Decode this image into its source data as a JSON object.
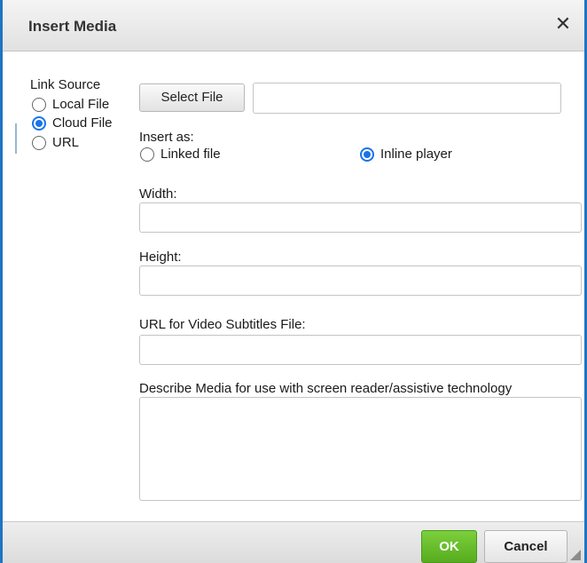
{
  "dialog": {
    "title": "Insert Media",
    "close_glyph": "✕",
    "close_icon": "close-icon"
  },
  "link_source": {
    "label": "Link Source",
    "options": [
      {
        "label": "Local File",
        "checked": false
      },
      {
        "label": "Cloud File",
        "checked": true
      },
      {
        "label": "URL",
        "checked": false
      }
    ]
  },
  "file": {
    "select_button": "Select File",
    "path_value": ""
  },
  "insert_as": {
    "label": "Insert as:",
    "options": [
      {
        "label": "Linked file",
        "checked": false
      },
      {
        "label": "Inline player",
        "checked": true
      }
    ]
  },
  "fields": {
    "width_label": "Width:",
    "width_value": "",
    "height_label": "Height:",
    "height_value": "",
    "subtitles_label": "URL for Video Subtitles File:",
    "subtitles_value": "",
    "describe_label": "Describe Media for use with screen reader/assistive technology",
    "describe_value": ""
  },
  "footer": {
    "ok_label": "OK",
    "cancel_label": "Cancel"
  },
  "colors": {
    "accent": "#1a73e8",
    "ok_green": "#5fb526",
    "frame_blue": "#1f74c2"
  }
}
